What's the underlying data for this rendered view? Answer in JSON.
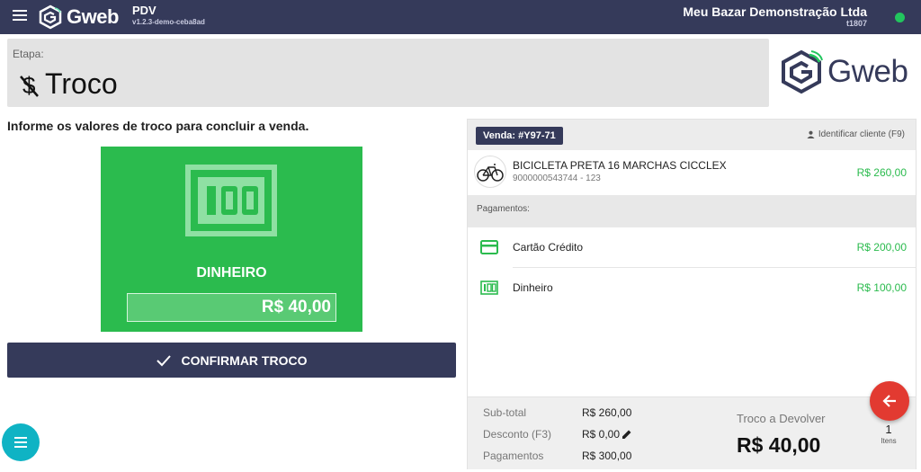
{
  "topbar": {
    "brand": "Gweb",
    "app_name": "PDV",
    "app_version": "v1.2.3-demo-ceba8ad",
    "store_name": "Meu Bazar Demonstração Ltda",
    "terminal": "t1807",
    "status_color": "#22c55e"
  },
  "stage": {
    "label": "Etapa:",
    "title": "Troco"
  },
  "logo": {
    "text": "Gweb"
  },
  "instruction": "Informe os valores de troco para concluir a venda.",
  "payment_method_card": {
    "label": "DINHEIRO",
    "value": "R$ 40,00",
    "icon": "cash-100-icon",
    "color": "#2bbb4e"
  },
  "confirm_button": {
    "label": "CONFIRMAR TROCO"
  },
  "sale_panel": {
    "sale_badge": "Venda: #Y97-71",
    "identify_client": "Identificar cliente (F9)",
    "product": {
      "name": "BICICLETA PRETA 16 MARCHAS CICCLEX",
      "code": "9000000543744 - 123",
      "price": "R$ 260,00"
    },
    "payments_header": "Pagamentos:",
    "payments": [
      {
        "name": "Cartão Crédito",
        "value": "R$ 200,00",
        "icon": "credit-card-icon"
      },
      {
        "name": "Dinheiro",
        "value": "R$ 100,00",
        "icon": "cash-100-icon"
      }
    ],
    "totals": {
      "subtotal_label": "Sub-total",
      "subtotal_value": "R$ 260,00",
      "discount_label": "Desconto (F3)",
      "discount_value": "R$ 0,00",
      "payments_label": "Pagamentos",
      "payments_value": "R$ 300,00",
      "change_label": "Troco a Devolver",
      "change_value": "R$ 40,00",
      "items_count": "1",
      "items_label": "Itens"
    }
  },
  "colors": {
    "navy": "#353a5a",
    "green": "#2bbb4e",
    "teal": "#0fb3c4",
    "red": "#e23a31"
  }
}
